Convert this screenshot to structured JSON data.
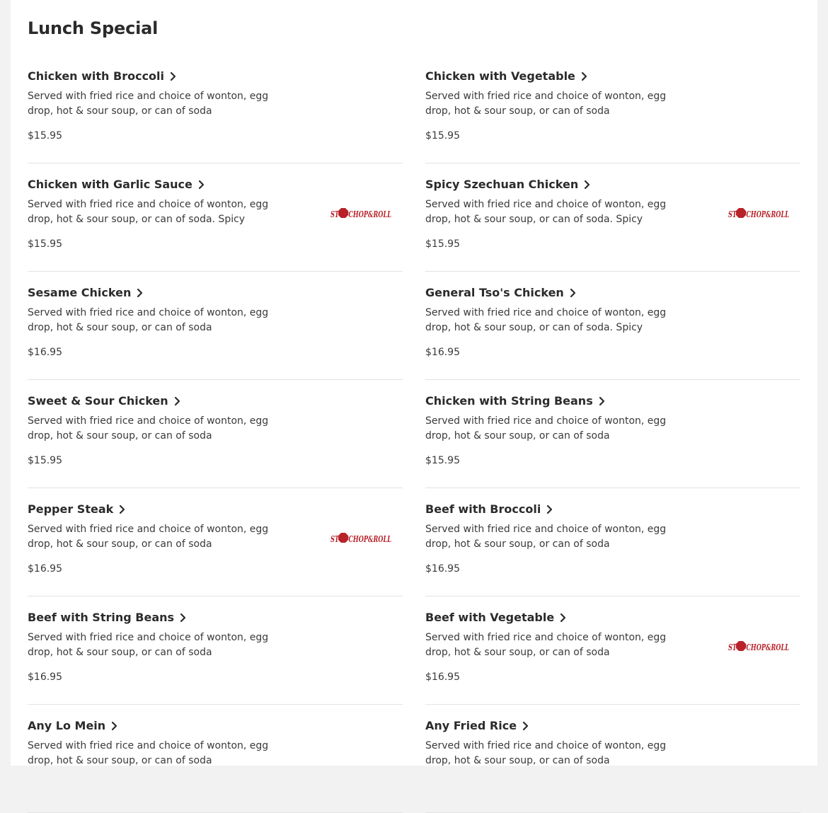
{
  "section": {
    "title": "Lunch Special"
  },
  "logo_text": "STOPCHOP&ROLL",
  "colors": {
    "accent_red": "#b8232a",
    "text": "#2b2b2b",
    "divider": "#e3e3e3"
  },
  "items": [
    {
      "name": "Chicken with Broccoli",
      "desc": "Served with fried rice and choice of wonton, egg drop, hot & sour soup, or can of soda",
      "price": "$15.95",
      "has_image": false
    },
    {
      "name": "Chicken with Vegetable",
      "desc": "Served with fried rice and choice of wonton, egg drop, hot & sour soup, or can of soda",
      "price": "$15.95",
      "has_image": false
    },
    {
      "name": "Chicken with Garlic Sauce",
      "desc": "Served with fried rice and choice of wonton, egg drop, hot & sour soup, or can of soda. Spicy",
      "price": "$15.95",
      "has_image": true
    },
    {
      "name": "Spicy Szechuan Chicken",
      "desc": "Served with fried rice and choice of wonton, egg drop, hot & sour soup, or can of soda. Spicy",
      "price": "$15.95",
      "has_image": true
    },
    {
      "name": "Sesame Chicken",
      "desc": "Served with fried rice and choice of wonton, egg drop, hot & sour soup, or can of soda",
      "price": "$16.95",
      "has_image": false
    },
    {
      "name": "General Tso's Chicken",
      "desc": "Served with fried rice and choice of wonton, egg drop, hot & sour soup, or can of soda. Spicy",
      "price": "$16.95",
      "has_image": false
    },
    {
      "name": "Sweet & Sour Chicken",
      "desc": "Served with fried rice and choice of wonton, egg drop, hot & sour soup, or can of soda",
      "price": "$15.95",
      "has_image": false
    },
    {
      "name": "Chicken with String Beans",
      "desc": "Served with fried rice and choice of wonton, egg drop, hot & sour soup, or can of soda",
      "price": "$15.95",
      "has_image": false
    },
    {
      "name": "Pepper Steak",
      "desc": "Served with fried rice and choice of wonton, egg drop, hot & sour soup, or can of soda",
      "price": "$16.95",
      "has_image": true
    },
    {
      "name": "Beef with Broccoli",
      "desc": "Served with fried rice and choice of wonton, egg drop, hot & sour soup, or can of soda",
      "price": "$16.95",
      "has_image": false
    },
    {
      "name": "Beef with String Beans",
      "desc": "Served with fried rice and choice of wonton, egg drop, hot & sour soup, or can of soda",
      "price": "$16.95",
      "has_image": false
    },
    {
      "name": "Beef with Vegetable",
      "desc": "Served with fried rice and choice of wonton, egg drop, hot & sour soup, or can of soda",
      "price": "$16.95",
      "has_image": true
    },
    {
      "name": "Any Lo Mein",
      "desc": "Served with fried rice and choice of wonton, egg drop, hot & sour soup, or can of soda",
      "price": "",
      "has_image": false
    },
    {
      "name": "Any Fried Rice",
      "desc": "Served with fried rice and choice of wonton, egg drop, hot & sour soup, or can of soda",
      "price": "",
      "has_image": false
    }
  ]
}
